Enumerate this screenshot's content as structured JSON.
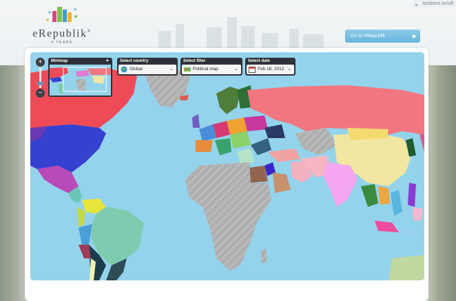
{
  "header": {
    "ambient_label": "Ambient on/off",
    "logo_text": "eRepublik",
    "logo_reg": "®",
    "logo_sub": "4 YEARS",
    "goto_button": "Go to eRepublik"
  },
  "controls": {
    "minimap": {
      "label": "Minimap"
    },
    "country": {
      "label": "Select country",
      "value": "Global"
    },
    "filter": {
      "label": "Select filter",
      "value": "Political map"
    },
    "date": {
      "label": "Select date",
      "value": "Feb 18, 2012"
    },
    "zoom": {
      "in": "+",
      "out": "−"
    }
  },
  "colors": {
    "ocean": "#94d3ec",
    "unclaimed": "#a9a9a9",
    "accent": "#67b4db"
  },
  "icons": {
    "ambient": "speaker-icon",
    "goto": "chevron-right-icon",
    "country": "globe-icon",
    "filter": "map-filter-icon",
    "date": "calendar-icon",
    "dropdown": "chevron-down-icon"
  }
}
